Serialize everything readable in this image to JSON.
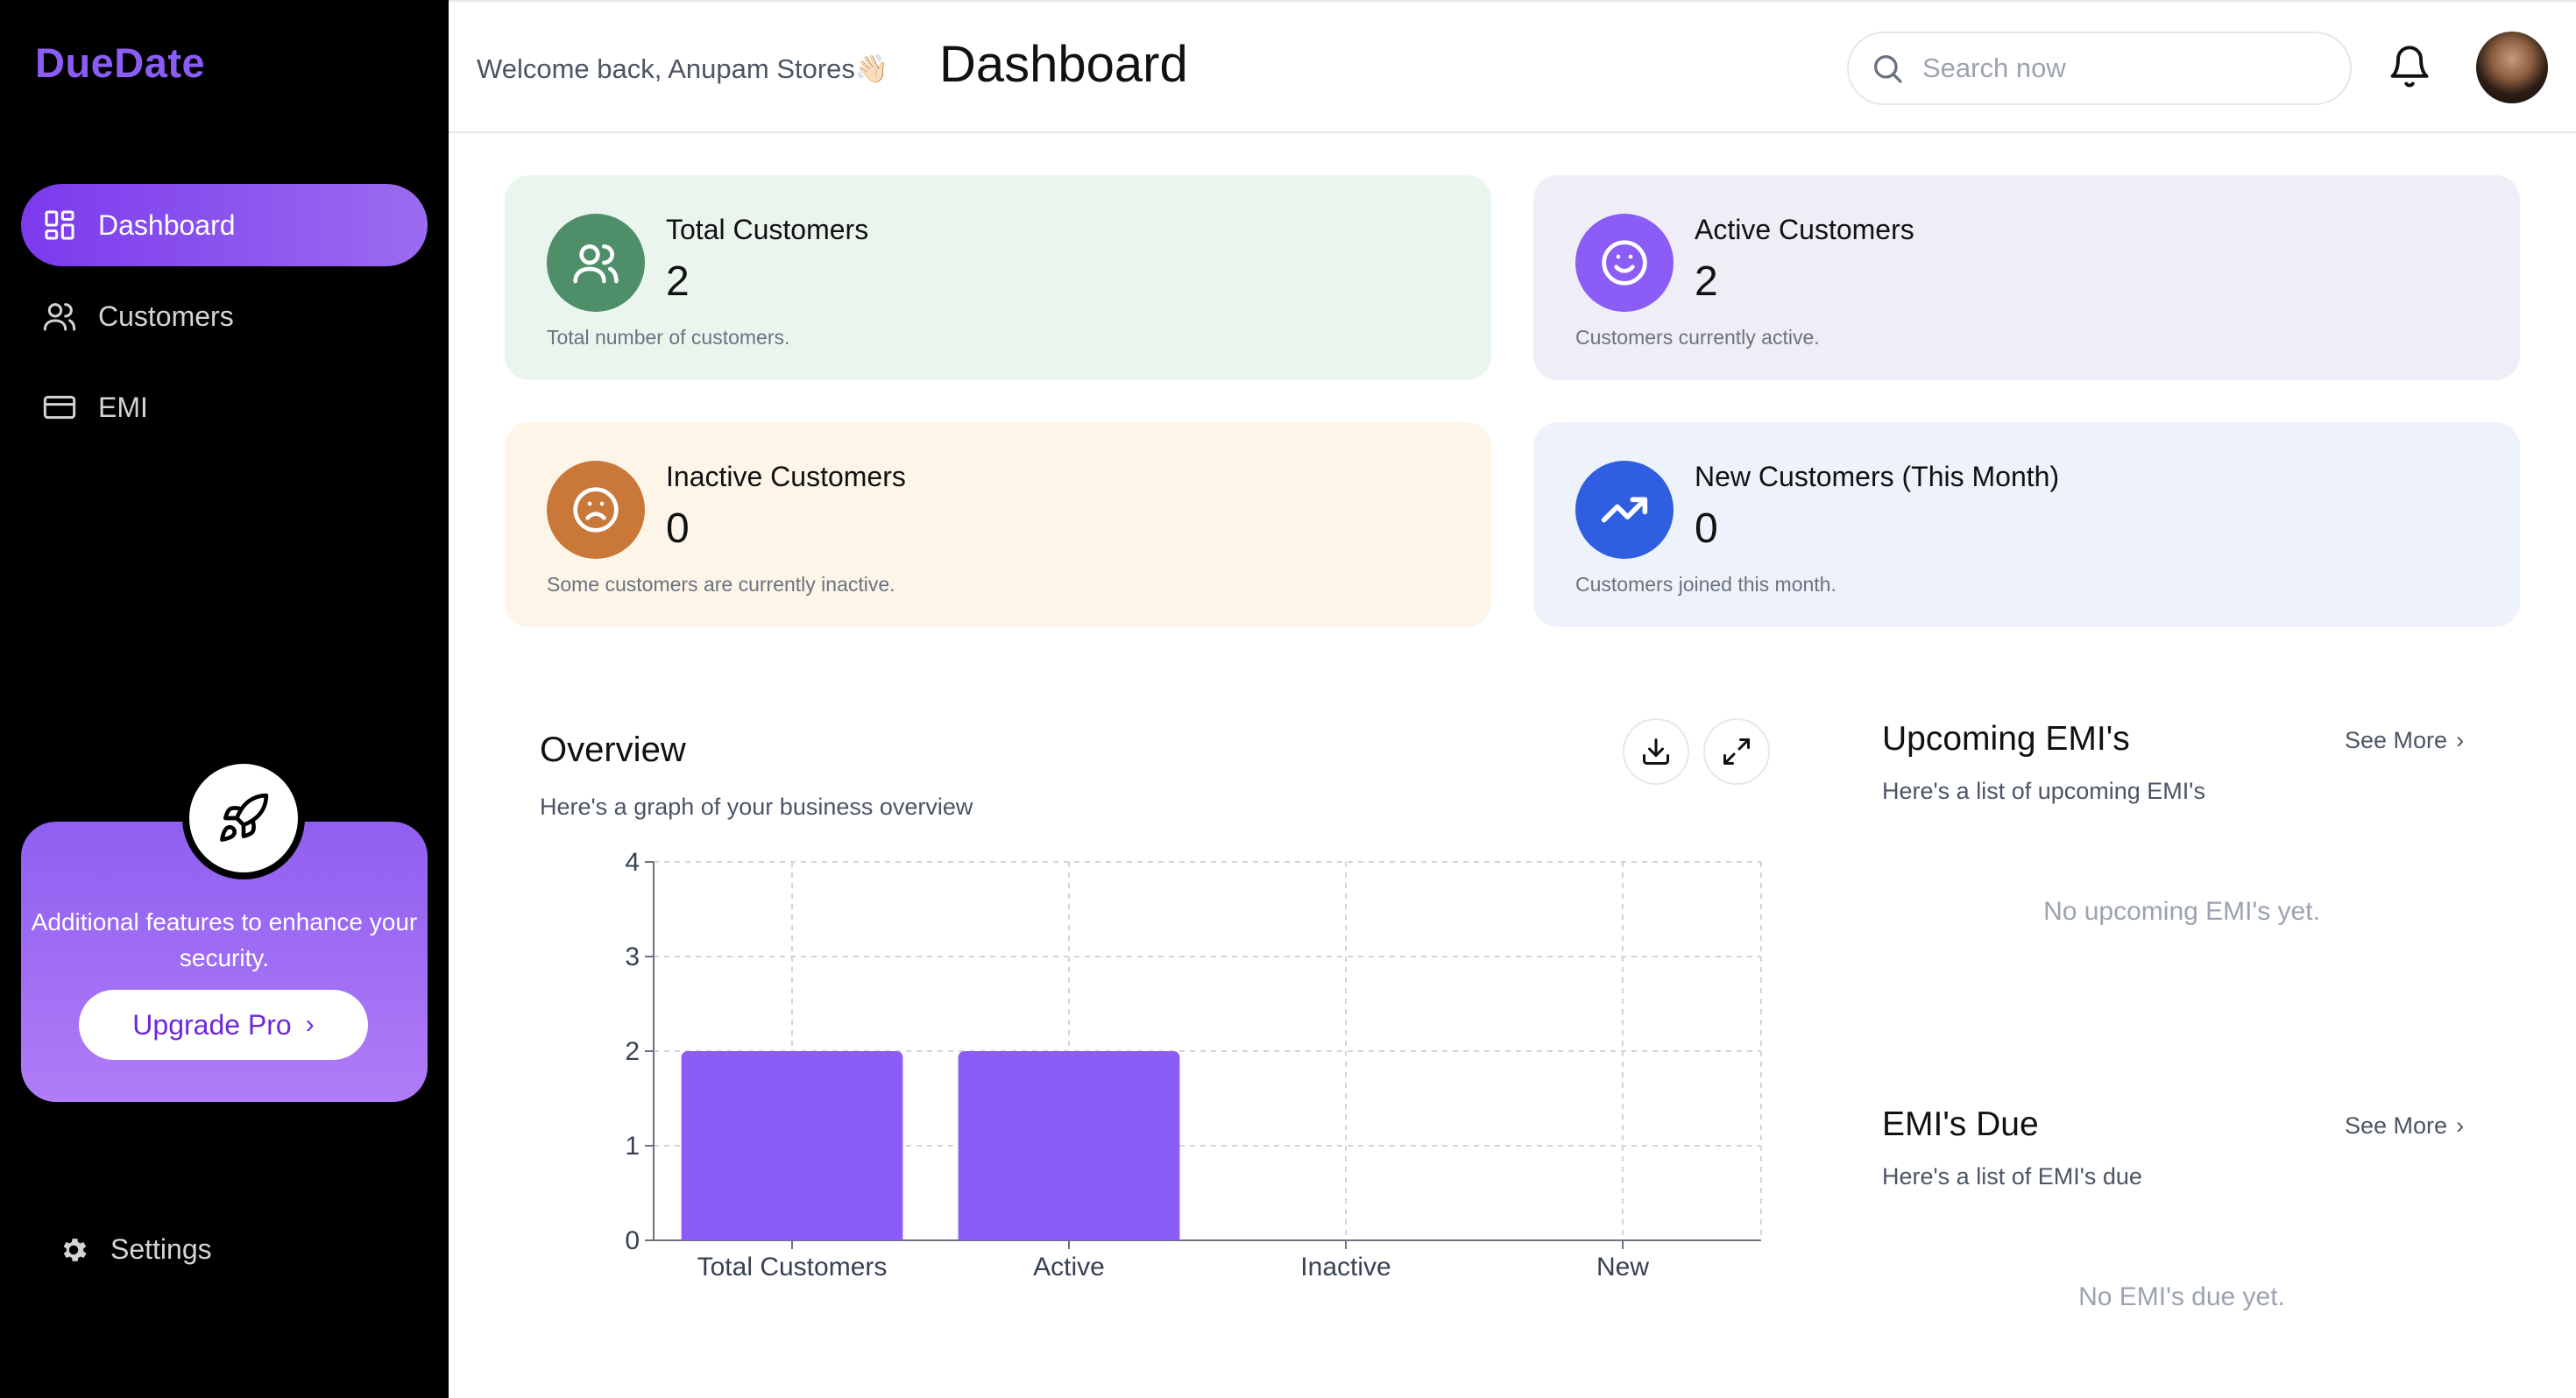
{
  "brand": {
    "name": "DueDate",
    "color": "#8b5cf6"
  },
  "sidebar": {
    "items": [
      {
        "label": "Dashboard",
        "icon": "grid-icon",
        "active": true
      },
      {
        "label": "Customers",
        "icon": "users-icon",
        "active": false
      },
      {
        "label": "EMI",
        "icon": "credit-card-icon",
        "active": false
      }
    ],
    "promo": {
      "icon": "rocket-icon",
      "text": "Additional features to enhance your security.",
      "button_label": "Upgrade Pro"
    },
    "settings_label": "Settings"
  },
  "header": {
    "welcome": "Welcome back, Anupam Stores👋🏻",
    "title": "Dashboard",
    "search_placeholder": "Search now"
  },
  "stats": [
    {
      "title": "Total Customers",
      "value": "2",
      "description": "Total number of customers.",
      "icon": "users-icon",
      "icon_color": "#4e8f6a"
    },
    {
      "title": "Active Customers",
      "value": "2",
      "description": "Customers currently active.",
      "icon": "smile-icon",
      "icon_color": "#8b5cf6"
    },
    {
      "title": "Inactive Customers",
      "value": "0",
      "description": "Some customers are currently inactive.",
      "icon": "frown-icon",
      "icon_color": "#c9783a"
    },
    {
      "title": "New Customers (This Month)",
      "value": "0",
      "description": "Customers joined this month.",
      "icon": "trending-up-icon",
      "icon_color": "#2f5fe0"
    }
  ],
  "overview": {
    "title": "Overview",
    "subtitle": "Here's a graph of your business overview"
  },
  "chart_data": {
    "type": "bar",
    "categories": [
      "Total Customers",
      "Active",
      "Inactive",
      "New"
    ],
    "values": [
      2,
      2,
      0,
      0
    ],
    "ylim": [
      0,
      4
    ],
    "yticks": [
      0,
      1,
      2,
      3,
      4
    ],
    "grid": true,
    "bar_color": "#8b5cf6"
  },
  "upcoming": {
    "title": "Upcoming EMI's",
    "subtitle": "Here's a list of upcoming EMI's",
    "see_more": "See More",
    "empty": "No upcoming EMI's yet."
  },
  "due": {
    "title": "EMI's Due",
    "subtitle": "Here's a list of EMI's due",
    "see_more": "See More",
    "empty": "No EMI's due yet."
  }
}
